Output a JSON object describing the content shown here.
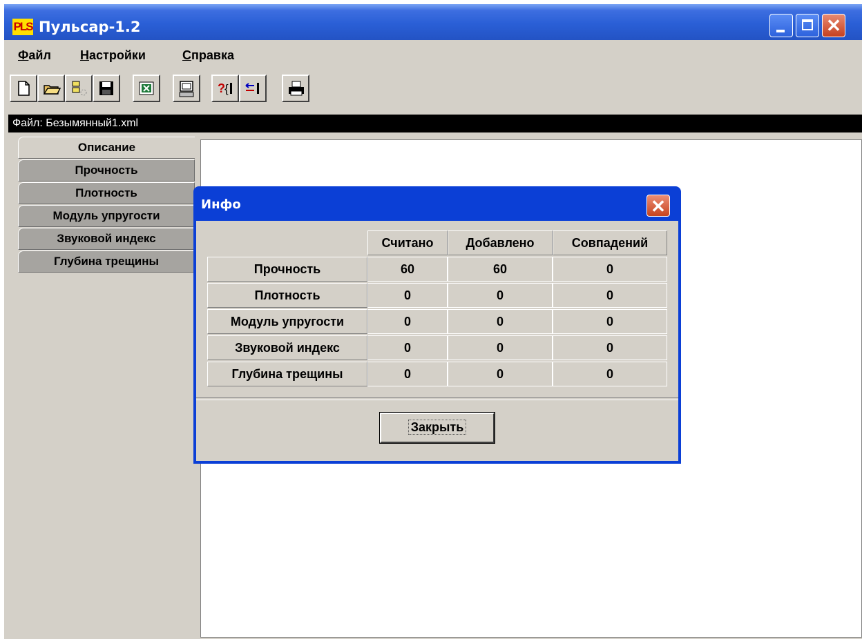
{
  "app": {
    "logo_text": "PLS",
    "title": "Пульсар-1.2"
  },
  "window_controls": {
    "close_glyph": "✕"
  },
  "menu": {
    "file": "Файл",
    "settings": "Настройки",
    "help": "Справка"
  },
  "toolbar": {
    "icons": [
      "new-document-icon",
      "open-folder-icon",
      "connect-device-icon",
      "save-icon",
      "excel-export-icon",
      "device-settings-icon",
      "help-icon",
      "transfer-icon",
      "print-icon"
    ]
  },
  "file_bar": {
    "text": "Файл: Безымянный1.xml"
  },
  "tabs": [
    {
      "label": "Описание"
    },
    {
      "label": "Прочность"
    },
    {
      "label": "Плотность"
    },
    {
      "label": "Модуль упругости"
    },
    {
      "label": "Звуковой индекс"
    },
    {
      "label": "Глубина трещины"
    }
  ],
  "dialog": {
    "title": "Инфо",
    "close_glyph": "✕",
    "columns": [
      "Считано",
      "Добавлено",
      "Совпадений"
    ],
    "rows": [
      {
        "label": "Прочность",
        "values": [
          "60",
          "60",
          "0"
        ]
      },
      {
        "label": "Плотность",
        "values": [
          "0",
          "0",
          "0"
        ]
      },
      {
        "label": "Модуль упругости",
        "values": [
          "0",
          "0",
          "0"
        ]
      },
      {
        "label": "Звуковой индекс",
        "values": [
          "0",
          "0",
          "0"
        ]
      },
      {
        "label": "Глубина трещины",
        "values": [
          "0",
          "0",
          "0"
        ]
      }
    ],
    "close_button": "Закрыть"
  }
}
